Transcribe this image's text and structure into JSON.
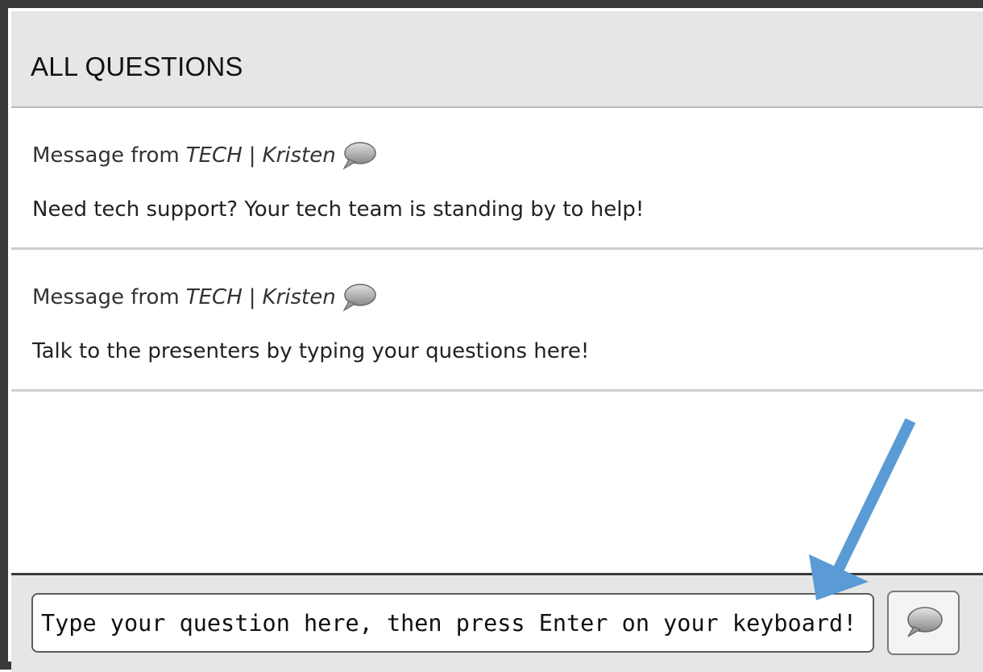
{
  "panel": {
    "title": "ALL QUESTIONS"
  },
  "messages": [
    {
      "prefix": "Message from",
      "sender": "TECH",
      "separator": "|",
      "author": "Kristen",
      "body": "Need tech support? Your tech team is standing by to help!"
    },
    {
      "prefix": "Message from",
      "sender": "TECH",
      "separator": "|",
      "author": "Kristen",
      "body": "Talk to the presenters by typing your questions here!"
    }
  ],
  "input": {
    "placeholder": "Type your question here, then press Enter on your keyboard!",
    "value": ""
  },
  "icons": {
    "message": "speech-bubble-icon",
    "send": "speech-bubble-icon",
    "annotation": "arrow-annotation"
  },
  "colors": {
    "arrow": "#5b9bd5",
    "header_bg": "#e6e6e6",
    "border": "#3a3a3a"
  }
}
